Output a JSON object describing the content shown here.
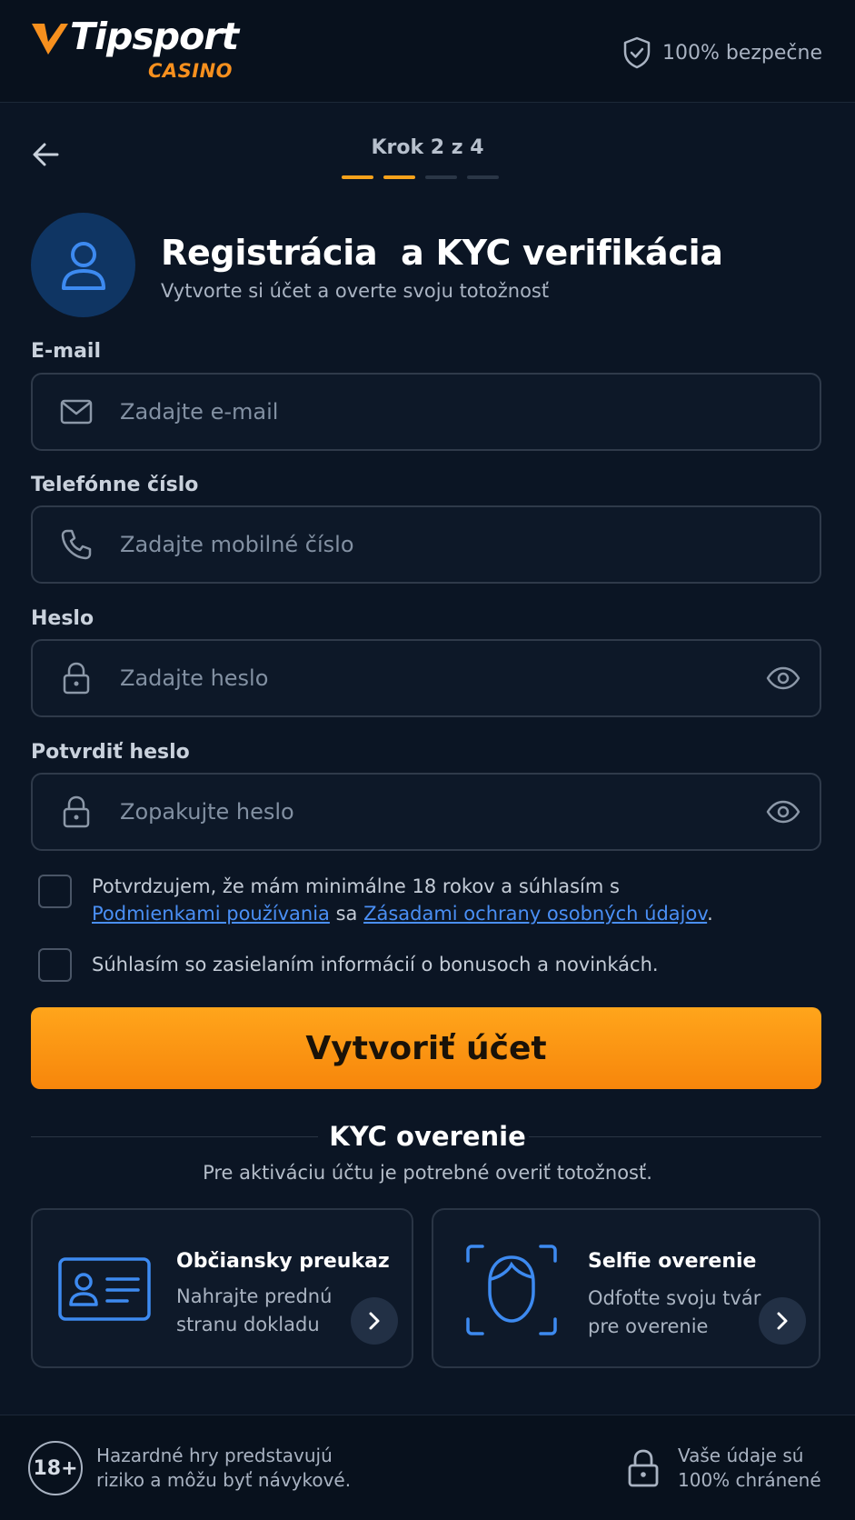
{
  "header": {
    "logo_main": "Tipsport",
    "logo_sub": "CASINO",
    "secure_text": "100% bezpečne",
    "brand_color": "#f7901e"
  },
  "progress": {
    "step_text": "Krok 2 z 4",
    "current_step": 2,
    "total_steps": 4
  },
  "page": {
    "title": "Registrácia  a KYC verifikácia",
    "subtitle": "Vytvorte si účet a overte svoju totožnosť"
  },
  "form": {
    "email": {
      "label": "E-mail",
      "placeholder": "Zadajte e-mail",
      "value": ""
    },
    "phone": {
      "label": "Telefónne číslo",
      "placeholder": "Zadajte mobilné číslo",
      "value": ""
    },
    "password": {
      "label": "Heslo",
      "placeholder": "Zadajte heslo",
      "value": ""
    },
    "password_confirm": {
      "label": "Potvrdiť heslo",
      "placeholder": "Zopakujte heslo",
      "value": ""
    }
  },
  "consents": {
    "age": {
      "text_before": "Potvrdzujem, že mám minimálne 18 rokov a súhlasím s",
      "link_terms": "Podmienkami používania",
      "between": " sa ",
      "link_privacy": "Zásadami ochrany osobných údajov",
      "after": ".",
      "checked": false
    },
    "marketing": {
      "text": "Súhlasím so zasielaním informácií o bonusoch a novinkách.",
      "checked": false
    }
  },
  "cta": {
    "label": "Vytvoriť účet",
    "color": "#f7931a"
  },
  "kyc": {
    "title": "KYC overenie",
    "subtitle": "Pre aktiváciu účtu je potrebné overiť totožnosť.",
    "cards": [
      {
        "title": "Občiansky preukaz",
        "desc_line1": "Nahrajte prednú",
        "desc_line2": "stranu dokladu",
        "icon": "id-card-icon"
      },
      {
        "title": "Selfie overenie",
        "desc_line1": "Odfoťte svoju tvár",
        "desc_line2": "pre overenie",
        "icon": "face-scan-icon"
      }
    ]
  },
  "footer": {
    "age_badge": "18+",
    "gambling_line1": "Hazardné hry predstavujú",
    "gambling_line2": "riziko a môžu byť návykové.",
    "secure_line1": "Vaše údaje sú",
    "secure_line2": "100% chránené"
  }
}
